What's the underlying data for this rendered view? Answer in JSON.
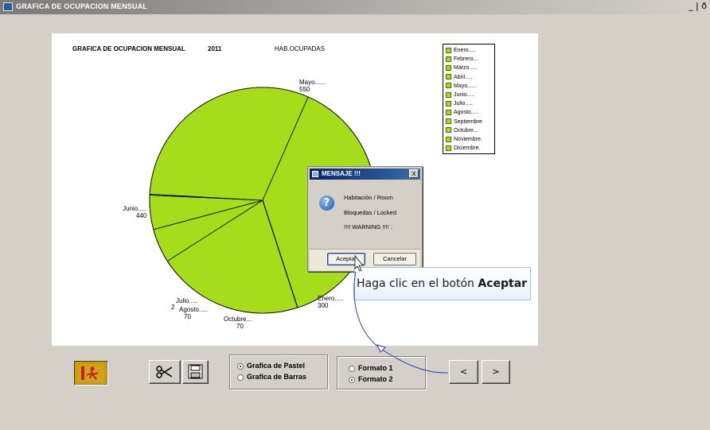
{
  "window": {
    "title": "GRAFICA DE OCUPACION MENSUAL",
    "controls": "_ | ð"
  },
  "chart_data": {
    "type": "pie",
    "title": "GRAFICA DE OCUPACION MENSUAL",
    "year": "2011",
    "series_label": "HAB.OCUPADAS",
    "categories": [
      "Enero.....",
      "Febrero...",
      "Marzo.....",
      "Abril.....",
      "Mayo......",
      "Junio.....",
      "Julio.....",
      "Agosto.....",
      "Septiembre",
      "Octubre...",
      "Noviembre.",
      "Diciembre."
    ],
    "values": [
      300,
      0,
      0,
      0,
      550,
      440,
      2,
      70,
      0,
      70,
      0,
      0
    ],
    "slice_labels": [
      {
        "name": "Mayo......",
        "value": "550"
      },
      {
        "name": "Junio.....",
        "value": "440"
      },
      {
        "name": "Julio.....",
        "value": "2"
      },
      {
        "name": "Agosto.....",
        "value": "70"
      },
      {
        "name": "Octubre...",
        "value": "70"
      },
      {
        "name": "Enero.....",
        "value": "300"
      }
    ],
    "slice_color": "#a6dd1b",
    "legend": [
      "Enero.....",
      "Febrero...",
      "Marzo.....",
      "Abril.....",
      "Mayo......",
      "Junio.....",
      "Julio.....",
      "Agosto.....",
      "Septiembre",
      "Octubre...",
      "Noviembre.",
      "Diciembre."
    ],
    "legend_position": "top-right"
  },
  "dialog": {
    "title": "MENSAJE !!!",
    "close_glyph": "x",
    "icon": "question-icon",
    "line1": "Habitación / Room",
    "line2": "Bloquedas / Locked",
    "line3": "!!!! WARNING !!!! :",
    "ok_label": "Aceptar",
    "cancel_label": "Cancelar"
  },
  "tooltip": {
    "prefix": "Haga clic en el botón",
    "bold": "Aceptar"
  },
  "options": {
    "chart_type": {
      "pastel": "Grafica de Pastel",
      "barras": "Grafica de Barras",
      "selected": "pastel"
    },
    "format": {
      "f1": "Formato 1",
      "f2": "Formato 2",
      "selected": "f2"
    }
  },
  "nav": {
    "prev": "<",
    "next": ">"
  },
  "icons": {
    "exit": "exit-icon",
    "cut": "scissors-icon",
    "save": "floppy-disk-icon"
  }
}
